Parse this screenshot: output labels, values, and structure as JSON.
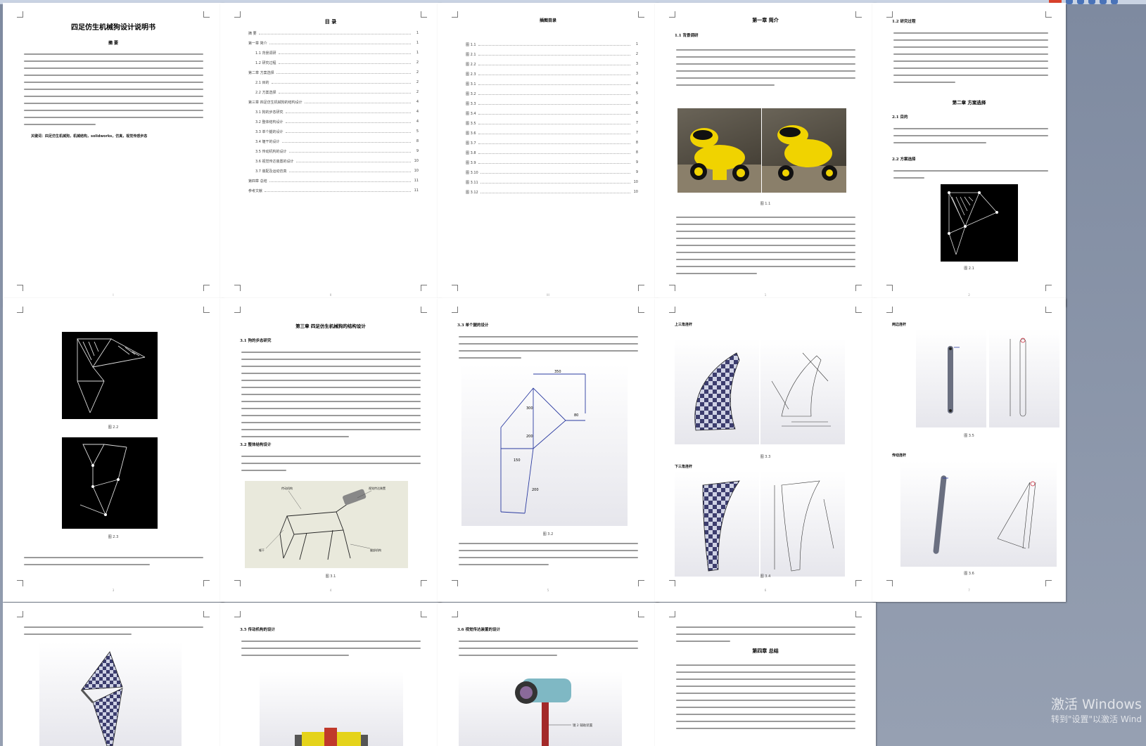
{
  "pages": {
    "p1": {
      "title": "四足仿生机械狗设计说明书",
      "abstract_heading": "摘 要",
      "keywords": "关键词：四足仿生机械狗，机械结构，solidworks，仿真，视觉传感步态"
    },
    "p2": {
      "title": "目 录",
      "toc": [
        {
          "t": "摘 要",
          "n": "1"
        },
        {
          "t": "第一章 简介",
          "n": "1"
        },
        {
          "t": "1.1 背景调研",
          "n": "1"
        },
        {
          "t": "1.2 研究过程",
          "n": "2"
        },
        {
          "t": "第二章 方案选择",
          "n": "2"
        },
        {
          "t": "2.1 目的",
          "n": "2"
        },
        {
          "t": "2.2 方案选择",
          "n": "2"
        },
        {
          "t": "第三章 四足仿生机械狗的结构设计",
          "n": "4"
        },
        {
          "t": "3.1 狗的步态研究",
          "n": "4"
        },
        {
          "t": "3.2 整体结构设计",
          "n": "4"
        },
        {
          "t": "3.3 单个腿的设计",
          "n": "5"
        },
        {
          "t": "3.4 躯干的设计",
          "n": "8"
        },
        {
          "t": "3.5 传动机构的设计",
          "n": "9"
        },
        {
          "t": "3.6 视觉传达装置的设计",
          "n": "10"
        },
        {
          "t": "3.7 装配及运动仿真",
          "n": "10"
        },
        {
          "t": "第四章 总结",
          "n": "11"
        },
        {
          "t": "参考文献",
          "n": "11"
        }
      ]
    },
    "p3": {
      "title": "插图目录",
      "toc": [
        {
          "t": "图 1.1",
          "n": "1"
        },
        {
          "t": "图 2.1",
          "n": "2"
        },
        {
          "t": "图 2.2",
          "n": "3"
        },
        {
          "t": "图 2.3",
          "n": "3"
        },
        {
          "t": "图 3.1",
          "n": "4"
        },
        {
          "t": "图 3.2",
          "n": "5"
        },
        {
          "t": "图 3.3",
          "n": "6"
        },
        {
          "t": "图 3.4",
          "n": "6"
        },
        {
          "t": "图 3.5",
          "n": "7"
        },
        {
          "t": "图 3.6",
          "n": "7"
        },
        {
          "t": "图 3.7",
          "n": "8"
        },
        {
          "t": "图 3.8",
          "n": "8"
        },
        {
          "t": "图 3.9",
          "n": "9"
        },
        {
          "t": "图 3.10",
          "n": "9"
        },
        {
          "t": "图 3.11",
          "n": "10"
        },
        {
          "t": "图 3.12",
          "n": "10"
        }
      ]
    },
    "p4": {
      "title": "第一章 简介",
      "section": "1.1 背景调研",
      "caption": "图 1.1"
    },
    "p5": {
      "section1": "1.2 研究过程",
      "chapter": "第二章 方案选择",
      "section2": "2.1 目的",
      "section3": "2.2 方案选择",
      "caption": "图 2.1"
    },
    "p6": {
      "caption1": "图 2.2",
      "caption2": "图 2.3"
    },
    "p7": {
      "title": "第三章 四足仿生机械狗的结构设计",
      "section1": "3.1 狗的步态研究",
      "section2": "3.2 整体结构设计",
      "caption": "图 3.1",
      "labels": [
        "传动机构",
        "视觉传达装置",
        "躯干",
        "腿部机构"
      ]
    },
    "p8": {
      "section": "3.3 单个腿的设计",
      "caption": "图 3.2",
      "dims": [
        "350",
        "300",
        "80",
        "200",
        "150",
        "200"
      ]
    },
    "p9": {
      "section1": "上三角连杆",
      "caption1": "图 3.3",
      "section2": "下三角连杆",
      "caption2": "图 3.4"
    },
    "p10": {
      "section1": "两边连杆",
      "caption1": "图 3.5",
      "section2": "传动连杆",
      "caption2": "图 3.6"
    },
    "p11": {},
    "p12": {
      "section": "3.5 传动机构的设计"
    },
    "p13": {
      "section": "3.6 视觉传达装置的设计",
      "label": "镜 2 辅助装置"
    },
    "p14": {
      "chapter": "第四章 总结"
    }
  },
  "watermark": {
    "line1": "激活 Windows",
    "line2": "转到\"设置\"以激活 Wind"
  },
  "colors": {
    "desktop": "#8a95a8",
    "page": "#ffffff",
    "dog_yellow": "#f0d300"
  }
}
